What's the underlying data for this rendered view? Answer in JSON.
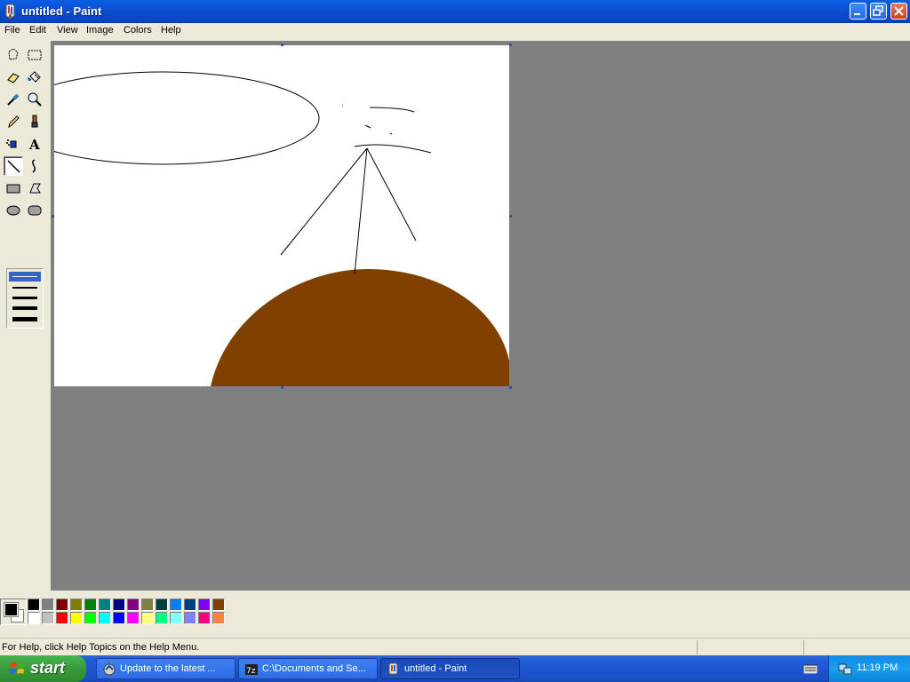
{
  "window": {
    "title": "untitled - Paint"
  },
  "menu": [
    "File",
    "Edit",
    "View",
    "Image",
    "Colors",
    "Help"
  ],
  "tools": [
    "free-form-select",
    "select",
    "eraser",
    "fill-with-color",
    "pick-color",
    "magnifier",
    "pencil",
    "brush",
    "airbrush",
    "text",
    "line",
    "curve",
    "rectangle",
    "polygon",
    "ellipse",
    "rounded-rectangle"
  ],
  "selected_tool": "line",
  "palette": {
    "top": [
      "#000000",
      "#808080",
      "#800000",
      "#808000",
      "#008000",
      "#008080",
      "#000080",
      "#800080",
      "#808040",
      "#004040",
      "#0080ff",
      "#004080",
      "#8000ff",
      "#804000"
    ],
    "bottom": [
      "#ffffff",
      "#c0c0c0",
      "#ff0000",
      "#ffff00",
      "#00ff00",
      "#00ffff",
      "#0000ff",
      "#ff00ff",
      "#ffff80",
      "#00ff80",
      "#80ffff",
      "#8080ff",
      "#ff0080",
      "#ff8040"
    ]
  },
  "foreground_color": "#000000",
  "background_color": "#ffffff",
  "status": {
    "help_text": "For Help, click Help Topics on the Help Menu."
  },
  "taskbar": {
    "start_label": "start",
    "tasks": [
      {
        "label": "Update to the latest ...",
        "icon": "update-icon",
        "active": false
      },
      {
        "label": "C:\\Documents and Se...",
        "icon": "7zip-icon",
        "active": false
      },
      {
        "label": "untitled - Paint",
        "icon": "paint-icon",
        "active": true
      }
    ],
    "clock": "11:19 PM"
  },
  "drawing": {
    "mound_color": "#804000"
  }
}
